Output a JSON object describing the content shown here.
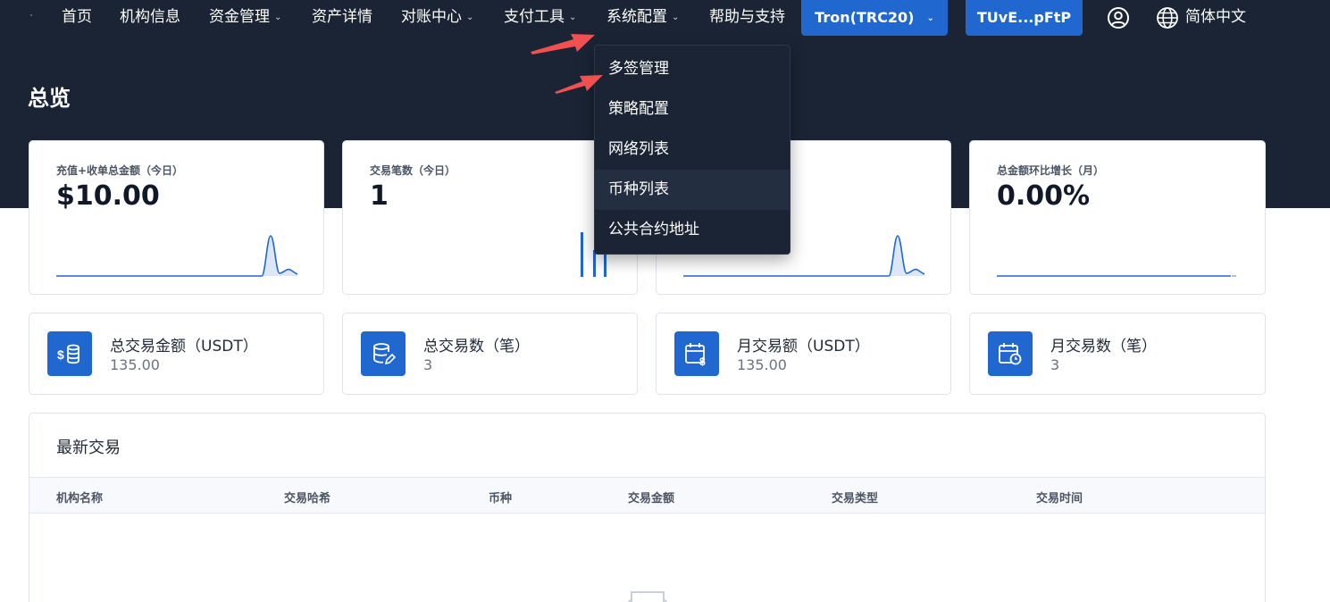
{
  "nav": {
    "items": [
      {
        "label": "首页",
        "has_dropdown": false
      },
      {
        "label": "机构信息",
        "has_dropdown": false
      },
      {
        "label": "资金管理",
        "has_dropdown": true
      },
      {
        "label": "资产详情",
        "has_dropdown": false
      },
      {
        "label": "对账中心",
        "has_dropdown": true
      },
      {
        "label": "支付工具",
        "has_dropdown": true
      },
      {
        "label": "系统配置",
        "has_dropdown": true
      },
      {
        "label": "帮助与支持",
        "has_dropdown": false
      }
    ],
    "network_button": "Tron(TRC20)",
    "wallet_button": "TUvE...pFtP",
    "language": "简体中文",
    "chevron": "⌄"
  },
  "page": {
    "title": "总览"
  },
  "stats": [
    {
      "label": "充值+收单总金额（今日）",
      "value": "$10.00"
    },
    {
      "label": "交易笔数（今日）",
      "value": "1"
    },
    {
      "label": "",
      "value": ""
    },
    {
      "label": "总金额环比增长（月）",
      "value": "0.00%"
    }
  ],
  "summary": [
    {
      "label": "总交易金额（USDT）",
      "value": "135.00",
      "icon": "coin-stack-icon"
    },
    {
      "label": "总交易数（笔）",
      "value": "3",
      "icon": "database-edit-icon"
    },
    {
      "label": "月交易额（USDT）",
      "value": "135.00",
      "icon": "calendar-dollar-icon"
    },
    {
      "label": "月交易数（笔）",
      "value": "3",
      "icon": "calendar-clock-icon"
    }
  ],
  "transactions": {
    "title": "最新交易",
    "columns": [
      "机构名称",
      "交易哈希",
      "币种",
      "交易金额",
      "交易类型",
      "交易时间"
    ]
  },
  "dropdown": {
    "items": [
      "多签管理",
      "策略配置",
      "网络列表",
      "币种列表",
      "公共合约地址"
    ],
    "hovered_index": 3
  },
  "colors": {
    "nav_bg": "#1a2434",
    "accent": "#2167d0",
    "annotation_arrow": "#f0504f"
  }
}
